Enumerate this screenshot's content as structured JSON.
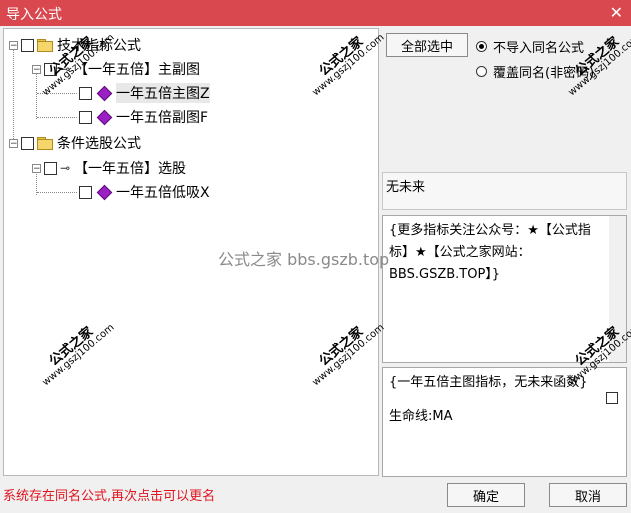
{
  "window": {
    "title": "导入公式",
    "close_glyph": "✕"
  },
  "tree": {
    "nodes": [
      {
        "label": "技术指标公式",
        "type": "folder"
      },
      {
        "label": "【一年五倍】主副图",
        "type": "key"
      },
      {
        "label": "一年五倍主图Z",
        "type": "formula"
      },
      {
        "label": "一年五倍副图F",
        "type": "formula"
      },
      {
        "label": "条件选股公式",
        "type": "folder"
      },
      {
        "label": "【一年五倍】选股",
        "type": "key"
      },
      {
        "label": "一年五倍低吸X",
        "type": "formula"
      }
    ]
  },
  "controls": {
    "select_all_label": "全部选中",
    "radio_skip_label": "不导入同名公式",
    "radio_overwrite_label": "覆盖同名(非密码)"
  },
  "panels": {
    "name_text": "无未来",
    "description_text": "{更多指标关注公众号：★【公式指标】★【公式之家网站：BBS.GSZB.TOP】}",
    "info_line1": "{一年五倍主图指标，无未来函数}",
    "info_line2": "生命线:MA"
  },
  "footer": {
    "status_text": "系统存在同名公式,再次点击可以更名",
    "ok_label": "确定",
    "cancel_label": "取消"
  },
  "watermark": {
    "text": "公式之家 bbs.gszb.top",
    "stamp_title": "公式之家",
    "stamp_url": "www.gszj100.com"
  },
  "colors": {
    "titlebar": "#d9484f",
    "status": "#e0141e",
    "formula_icon": "#9b1fc2"
  }
}
